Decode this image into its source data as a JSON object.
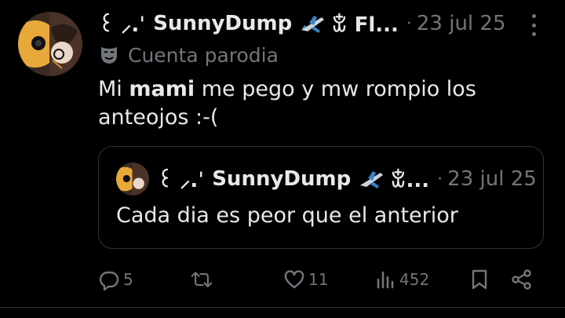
{
  "tweet": {
    "author_name_prefix": "꒰ ⸝.ˈ",
    "author_name": "SunnyDump",
    "author_name_suffix": "ꒃ Fl...",
    "separator": "·",
    "date": "23 jul 25",
    "badge_label": "Cuenta parodia",
    "text_before": "Mi ",
    "text_bold": "mami",
    "text_after": " me pego y mw rompio los anteojos :-("
  },
  "quoted_tweet": {
    "author_name_prefix": "꒰ ⸝.ˈ",
    "author_name": "SunnyDump",
    "author_name_suffix": "ꒃ...",
    "separator": "·",
    "date": "23 jul 25",
    "text": "Cada dia es peor que el anterior"
  },
  "actions": {
    "replies": "5",
    "reposts": "",
    "likes": "11",
    "views": "452"
  },
  "icons": {
    "badge": "theater-mask-icon",
    "name_emoji": "airplane-icon",
    "reply": "reply-icon",
    "repost": "repost-icon",
    "like": "heart-icon",
    "views": "views-icon",
    "bookmark": "bookmark-icon",
    "share": "share-icon",
    "more": "more-icon"
  },
  "colors": {
    "background": "#000000",
    "text": "#e7e9ea",
    "muted": "#71767b",
    "border": "#2f3336"
  }
}
